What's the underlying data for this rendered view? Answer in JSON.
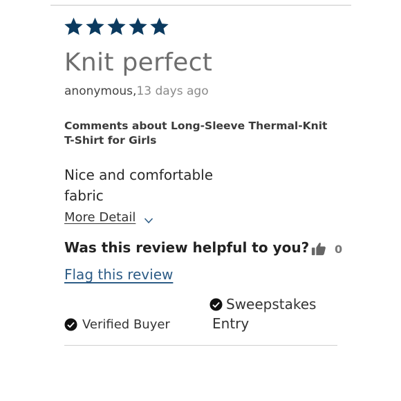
{
  "colors": {
    "star": "#0b3a5f",
    "title": "#6e6e6e",
    "link": "#2d5c86",
    "check": "#111111",
    "divider": "#c8c8c8"
  },
  "review": {
    "rating": 5,
    "rating_max": 5,
    "title": "Knit perfect",
    "author": "anonymous,",
    "age": "13 days ago",
    "comments_about": "Comments about Long-Sleeve Thermal-Knit T-Shirt for Girls",
    "body_line1": "Nice and comfortable",
    "body_line2": "fabric",
    "more_detail_label": "More Detail",
    "helpful_question": "Was this review helpful to you?",
    "helpful_count": "0",
    "flag_label": "Flag this review",
    "badges": {
      "verified_buyer": "Verified Buyer",
      "sweepstakes_line1": "Sweepstakes",
      "sweepstakes_line2": "Entry"
    }
  },
  "icons": {
    "star": "star-icon",
    "chevron": "chevron-down-icon",
    "thumb": "thumbs-up-icon",
    "check": "check-circle-icon"
  }
}
